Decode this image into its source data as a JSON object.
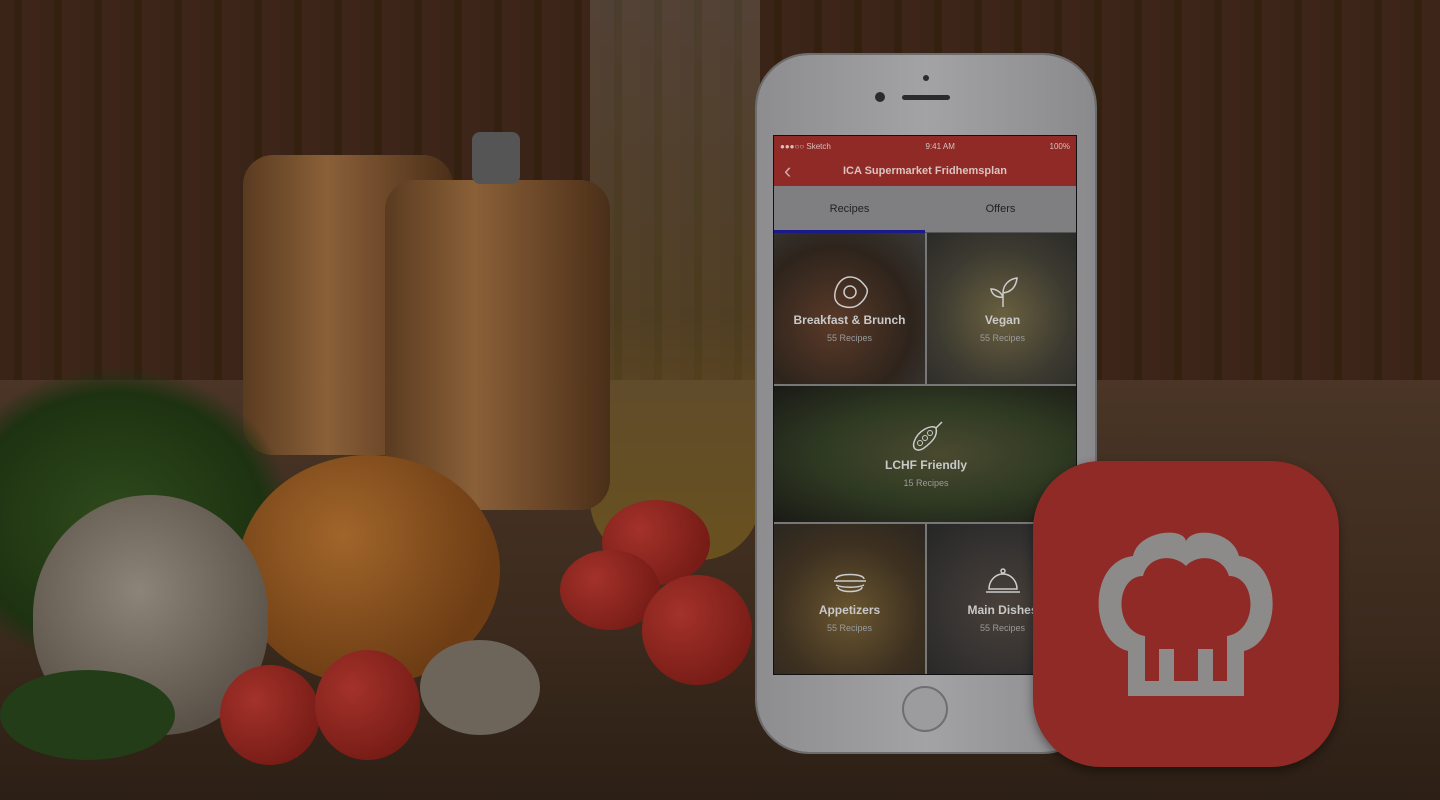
{
  "status_bar": {
    "carrier": "●●●○○ Sketch",
    "time": "9:41 AM",
    "battery": "100%"
  },
  "header": {
    "title": "ICA Supermarket Fridhemsplan",
    "back_icon": "chevron-left-icon"
  },
  "tabs": [
    {
      "label": "Recipes",
      "active": true
    },
    {
      "label": "Offers",
      "active": false
    }
  ],
  "categories": [
    {
      "title": "Breakfast & Brunch",
      "count": "55 Recipes",
      "icon": "egg-icon"
    },
    {
      "title": "Vegan",
      "count": "55 Recipes",
      "icon": "leaf-icon"
    },
    {
      "title": "LCHF Friendly",
      "count": "15 Recipes",
      "icon": "peapod-icon"
    },
    {
      "title": "Appetizers",
      "count": "55 Recipes",
      "icon": "sandwich-icon"
    },
    {
      "title": "Main Dishes",
      "count": "55 Recipes",
      "icon": "cloche-icon"
    }
  ],
  "colors": {
    "brand": "#8f2a26",
    "tab_indicator": "#1a1a8a"
  }
}
